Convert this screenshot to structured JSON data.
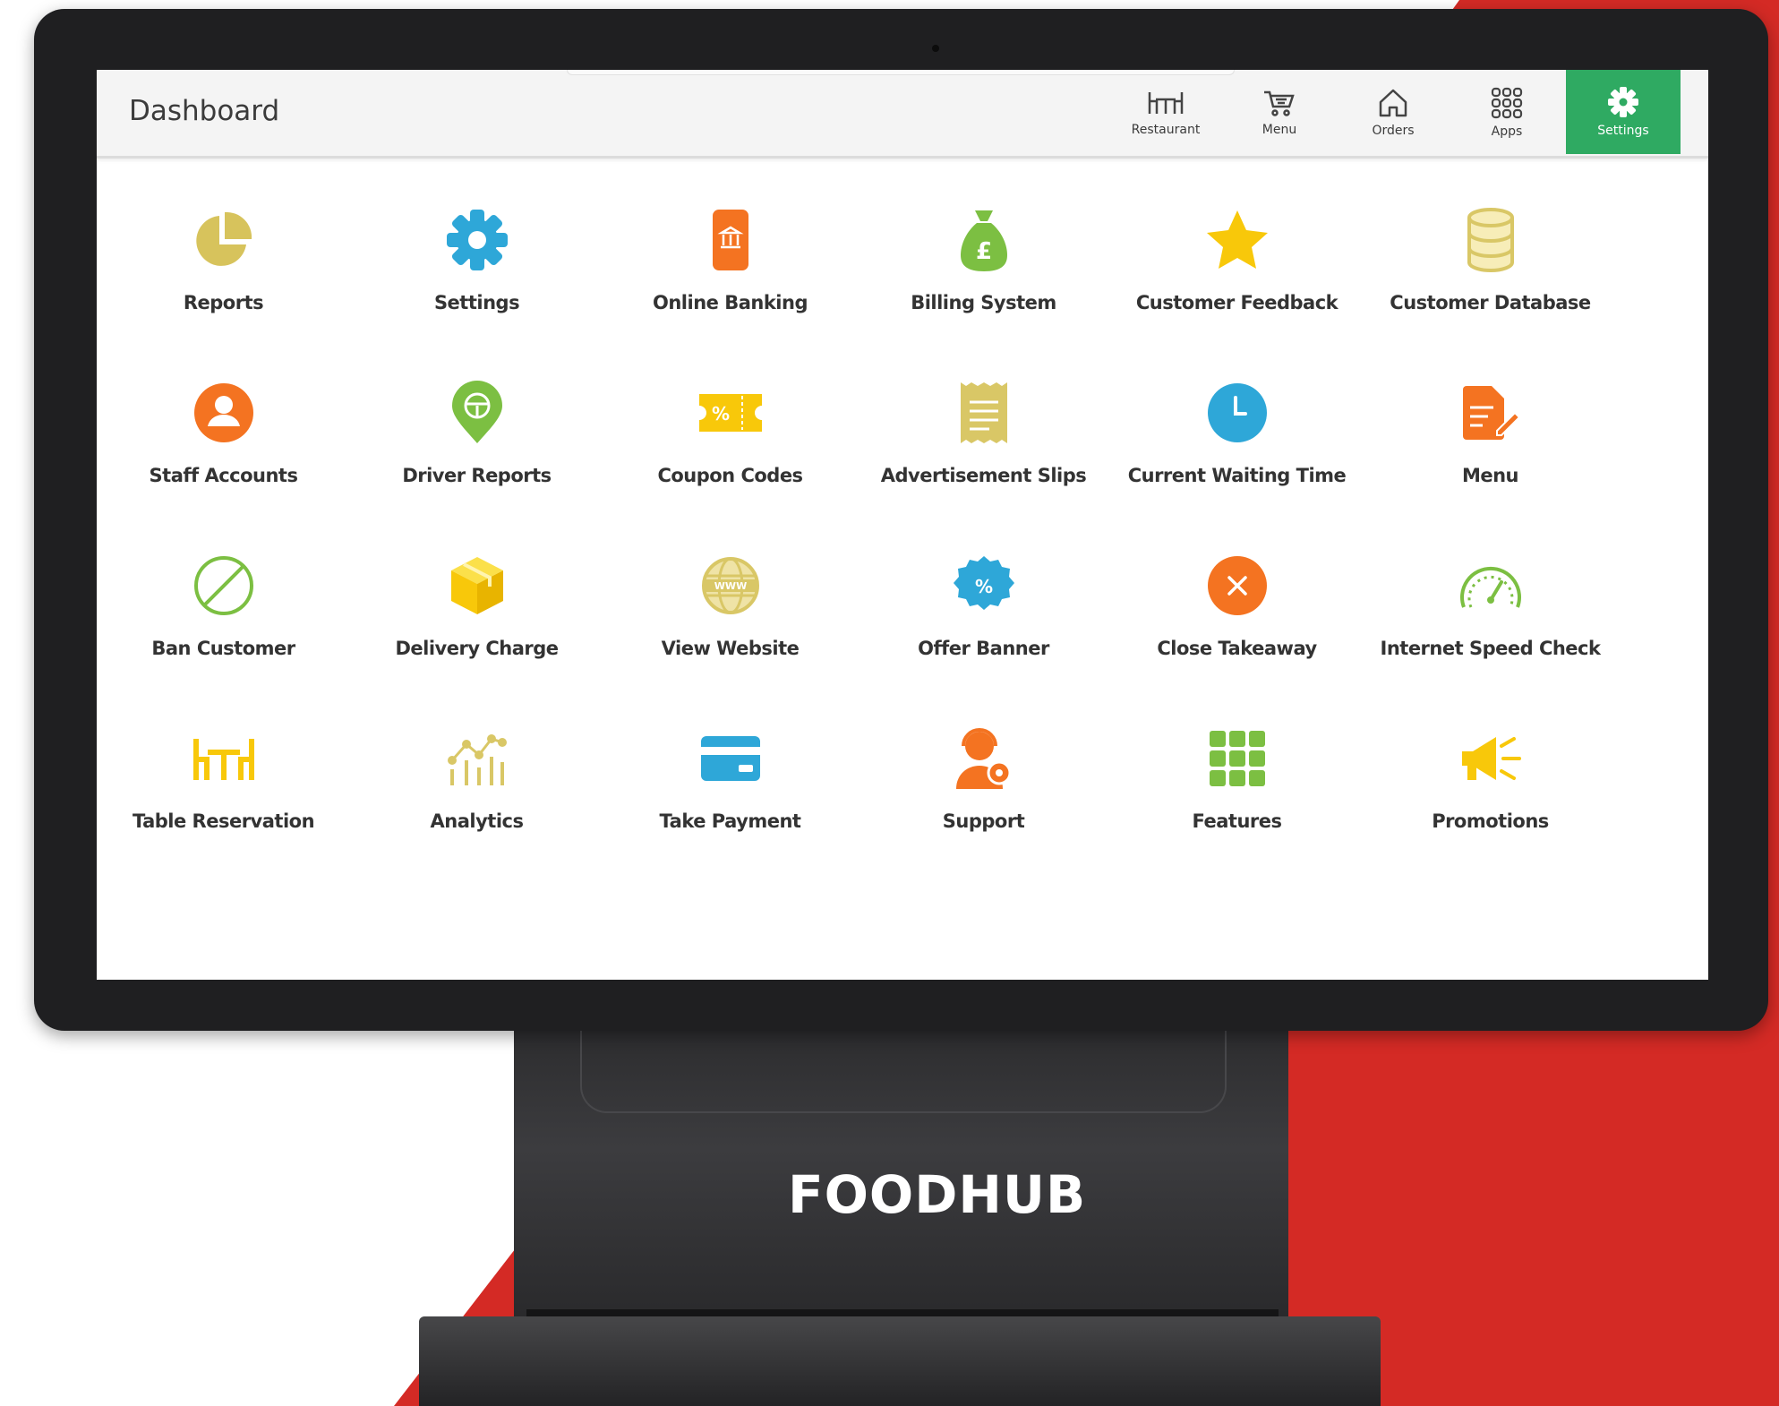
{
  "header": {
    "title": "Dashboard"
  },
  "nav": [
    {
      "label": "Restaurant",
      "icon": "table-icon"
    },
    {
      "label": "Menu",
      "icon": "cart-icon"
    },
    {
      "label": "Orders",
      "icon": "home-icon"
    },
    {
      "label": "Apps",
      "icon": "apps-grid-icon"
    },
    {
      "label": "Settings",
      "icon": "gear-icon",
      "active": true
    }
  ],
  "tiles": [
    {
      "label": "Reports",
      "icon": "pie-chart-icon",
      "color": "#d7c35c"
    },
    {
      "label": "Settings",
      "icon": "gear-icon",
      "color": "#2ea7d8"
    },
    {
      "label": "Online Banking",
      "icon": "phone-bank-icon",
      "color": "#f47321"
    },
    {
      "label": "Billing System",
      "icon": "money-bag-icon",
      "color": "#7cbf42"
    },
    {
      "label": "Customer Feedback",
      "icon": "star-icon",
      "color": "#f8c80a"
    },
    {
      "label": "Customer Database",
      "icon": "database-icon",
      "color": "#d9c766"
    },
    {
      "label": "Staff Accounts",
      "icon": "user-icon",
      "color": "#f47321"
    },
    {
      "label": "Driver Reports",
      "icon": "location-pin-icon",
      "color": "#7cbf42"
    },
    {
      "label": "Coupon Codes",
      "icon": "coupon-icon",
      "color": "#f8c80a"
    },
    {
      "label": "Advertisement Slips",
      "icon": "receipt-icon",
      "color": "#d9c766"
    },
    {
      "label": "Current Waiting Time",
      "icon": "clock-icon",
      "color": "#2ea7d8"
    },
    {
      "label": "Menu",
      "icon": "menu-edit-icon",
      "color": "#f47321"
    },
    {
      "label": "Ban Customer",
      "icon": "ban-icon",
      "color": "#7cbf42"
    },
    {
      "label": "Delivery Charge",
      "icon": "box-icon",
      "color": "#f8c80a"
    },
    {
      "label": "View Website",
      "icon": "globe-icon",
      "color": "#d9c766"
    },
    {
      "label": "Offer Banner",
      "icon": "discount-badge-icon",
      "color": "#2ea7d8"
    },
    {
      "label": "Close Takeaway",
      "icon": "close-icon",
      "color": "#f47321"
    },
    {
      "label": "Internet Speed Check",
      "icon": "speedometer-icon",
      "color": "#7cbf42"
    },
    {
      "label": "Table Reservation",
      "icon": "table-icon",
      "color": "#f8c80a"
    },
    {
      "label": "Analytics",
      "icon": "analytics-icon",
      "color": "#d9c766"
    },
    {
      "label": "Take Payment",
      "icon": "credit-card-icon",
      "color": "#2ea7d8"
    },
    {
      "label": "Support",
      "icon": "support-agent-icon",
      "color": "#f47321"
    },
    {
      "label": "Features",
      "icon": "grid-icon",
      "color": "#7cbf42"
    },
    {
      "label": "Promotions",
      "icon": "megaphone-icon",
      "color": "#f8c80a"
    }
  ],
  "brand": {
    "logo_text": "FOODHUB"
  },
  "colors": {
    "accent_green": "#2faa62",
    "background_red": "#d42a25"
  }
}
